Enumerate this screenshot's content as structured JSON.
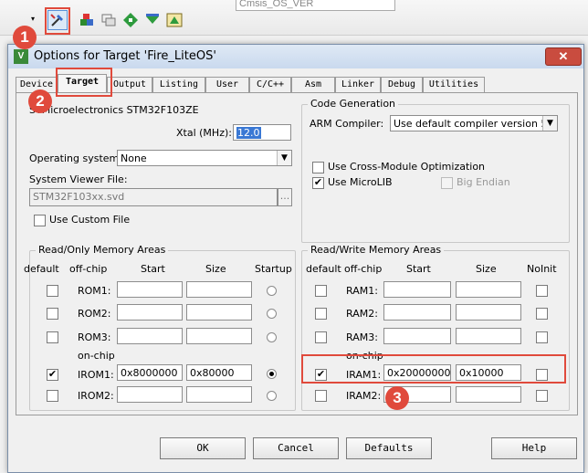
{
  "toolbar": {
    "project_target": "Cmsis_OS_VER",
    "icons": [
      "options-for-target-icon",
      "manage-components-icon",
      "file-extensions-icon",
      "select-packs-icon",
      "pack-installer-icon",
      "run-time-environment-icon"
    ]
  },
  "dialog": {
    "title": "Options for Target 'Fire_LiteOS'",
    "close_label": "✕",
    "tabs": [
      "Device",
      "Target",
      "Output",
      "Listing",
      "User",
      "C/C++",
      "Asm",
      "Linker",
      "Debug",
      "Utilities"
    ],
    "active_tab": "Target",
    "device_name": "STMicroelectronics STM32F103ZE",
    "xtal_label": "Xtal (MHz):",
    "xtal_value": "12.0",
    "os_label": "Operating system:",
    "os_value": "None",
    "svd_label": "System Viewer File:",
    "svd_value": "STM32F103xx.svd",
    "browse_label": "...",
    "custom_file_label": "Use Custom File",
    "code_gen": {
      "title": "Code Generation",
      "compiler_label": "ARM Compiler:",
      "compiler_value": "Use default compiler version 5",
      "cross_module_label": "Use Cross-Module Optimization",
      "microlib_label": "Use MicroLIB",
      "big_endian_label": "Big Endian"
    },
    "ro": {
      "title": "Read/Only Memory Areas",
      "headers": [
        "default",
        "off-chip",
        "Start",
        "Size",
        "Startup"
      ],
      "on_chip_label": "on-chip",
      "rows": [
        {
          "name": "ROM1:",
          "start": "",
          "size": ""
        },
        {
          "name": "ROM2:",
          "start": "",
          "size": ""
        },
        {
          "name": "ROM3:",
          "start": "",
          "size": ""
        },
        {
          "name": "IROM1:",
          "start": "0x8000000",
          "size": "0x80000"
        },
        {
          "name": "IROM2:",
          "start": "",
          "size": ""
        }
      ]
    },
    "rw": {
      "title": "Read/Write Memory Areas",
      "headers": [
        "default",
        "off-chip",
        "Start",
        "Size",
        "NoInit"
      ],
      "on_chip_label": "on-chip",
      "rows": [
        {
          "name": "RAM1:",
          "start": "",
          "size": ""
        },
        {
          "name": "RAM2:",
          "start": "",
          "size": ""
        },
        {
          "name": "RAM3:",
          "start": "",
          "size": ""
        },
        {
          "name": "IRAM1:",
          "start": "0x20000000",
          "size": "0x10000"
        },
        {
          "name": "IRAM2:",
          "start": "",
          "size": ""
        }
      ]
    },
    "buttons": {
      "ok": "OK",
      "cancel": "Cancel",
      "defaults": "Defaults",
      "help": "Help"
    }
  },
  "annotations": {
    "badge1": "1",
    "badge2": "2",
    "badge3": "3"
  },
  "colors": {
    "highlight": "#e04a3c",
    "title_bar": "#c9d9ee",
    "close": "#c94c3f"
  }
}
